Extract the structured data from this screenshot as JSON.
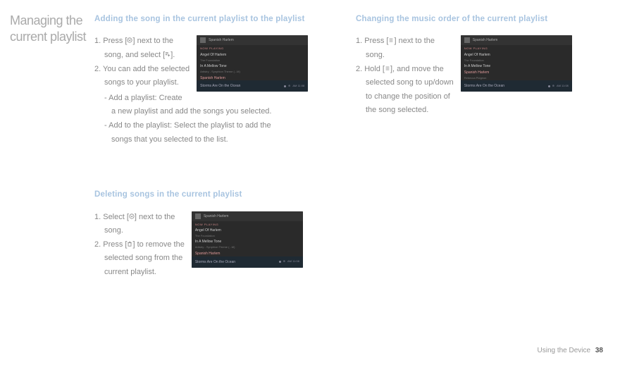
{
  "sidebar_title": "Managing the current playlist",
  "section1": {
    "title": "Adding the song in the current playlist to the playlist",
    "step1_a": "1. Press [",
    "step1_b": "] next to the",
    "step1_line2a": "song, and select [",
    "step1_line2b": "].",
    "step2": "2. You can add the selected",
    "step2_line2": "songs to your playlist.",
    "bullet1a": "- Add a playlist: Create",
    "bullet1b": "a new playlist and add the songs you selected.",
    "bullet2": "- Add to the playlist: Select the playlist to add the",
    "bullet2b": "songs that you selected to the list."
  },
  "section2": {
    "title": "Changing the music order of the current playlist",
    "step1_a": "1. Press [",
    "step1_b": "] next to the",
    "step1_line2": "song.",
    "step2_a": "2. Hold [",
    "step2_b": "], and move the",
    "step2_line2": "selected song to up/down",
    "step2_line3": "to change the position of",
    "step2_line4": "the song selected."
  },
  "section3": {
    "title": "Deleting songs in the current playlist",
    "step1_a": "1. Select [",
    "step1_b": "] next to the",
    "step1_line2": "song.",
    "step2_a": "2. Press [",
    "step2_b": "] to remove the",
    "step2_line2": "selected song from the",
    "step2_line3": "current playlist."
  },
  "thumb": {
    "now_playing": "NOW PLAYING",
    "t1": "Angel Of Harlem",
    "t1s": "The Foundation",
    "t2": "In A Mellow Tone",
    "t2s": "Artistry - Synphion Theme (...M)",
    "t3": "Spanish Harlem",
    "t3s": "Rebecca Pidgeon",
    "footer_txt": "Storms Are On the Ocean",
    "time": "AM 11:08",
    "header_title": "Spanish Harlem"
  },
  "footer": {
    "label": "Using the Device",
    "page": "38"
  }
}
